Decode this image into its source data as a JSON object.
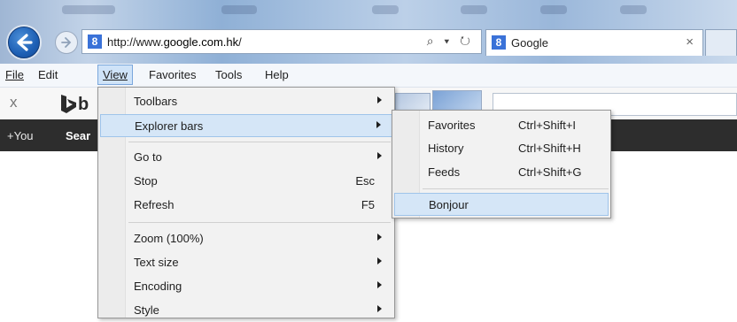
{
  "address_bar": {
    "url_prefix": "http://www.",
    "url_domain": "google.com.hk",
    "url_suffix": "/",
    "controls": "⌕ ▾ ↻",
    "favicon_letter": "8"
  },
  "tab": {
    "title": "Google",
    "close_label": "×",
    "favicon_letter": "8"
  },
  "menubar": {
    "file": "File",
    "edit": "Edit",
    "view": "View",
    "favorites": "Favorites",
    "tools": "Tools",
    "help": "Help"
  },
  "toolbar": {
    "close_label": "x",
    "bing_letter": "b"
  },
  "google_bar": {
    "plus_you": "+You",
    "search": "Sear"
  },
  "view_menu": {
    "toolbars": "Toolbars",
    "explorer_bars": "Explorer bars",
    "go_to": "Go to",
    "stop": "Stop",
    "stop_shortcut": "Esc",
    "refresh": "Refresh",
    "refresh_shortcut": "F5",
    "zoom": "Zoom (100%)",
    "text_size": "Text size",
    "encoding": "Encoding",
    "style": "Style"
  },
  "explorer_bars_menu": {
    "favorites": "Favorites",
    "favorites_shortcut": "Ctrl+Shift+I",
    "history": "History",
    "history_shortcut": "Ctrl+Shift+H",
    "feeds": "Feeds",
    "feeds_shortcut": "Ctrl+Shift+G",
    "bonjour": "Bonjour"
  },
  "colors": {
    "menu_highlight": "#d5e6f7",
    "back_button": "#1d5fb4",
    "google_bar": "#2d2d2d"
  }
}
